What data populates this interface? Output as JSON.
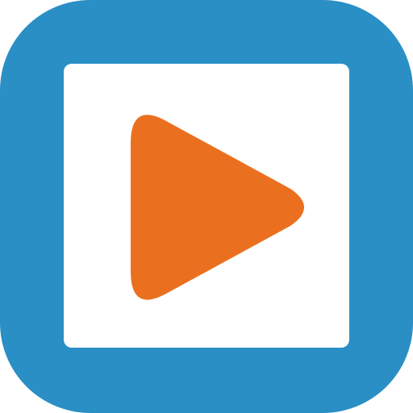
{
  "app_icon": {
    "icon_name": "play-icon",
    "colors": {
      "frame": "#2a8fc5",
      "panel": "#ffffff",
      "play": "#ea701f"
    }
  }
}
